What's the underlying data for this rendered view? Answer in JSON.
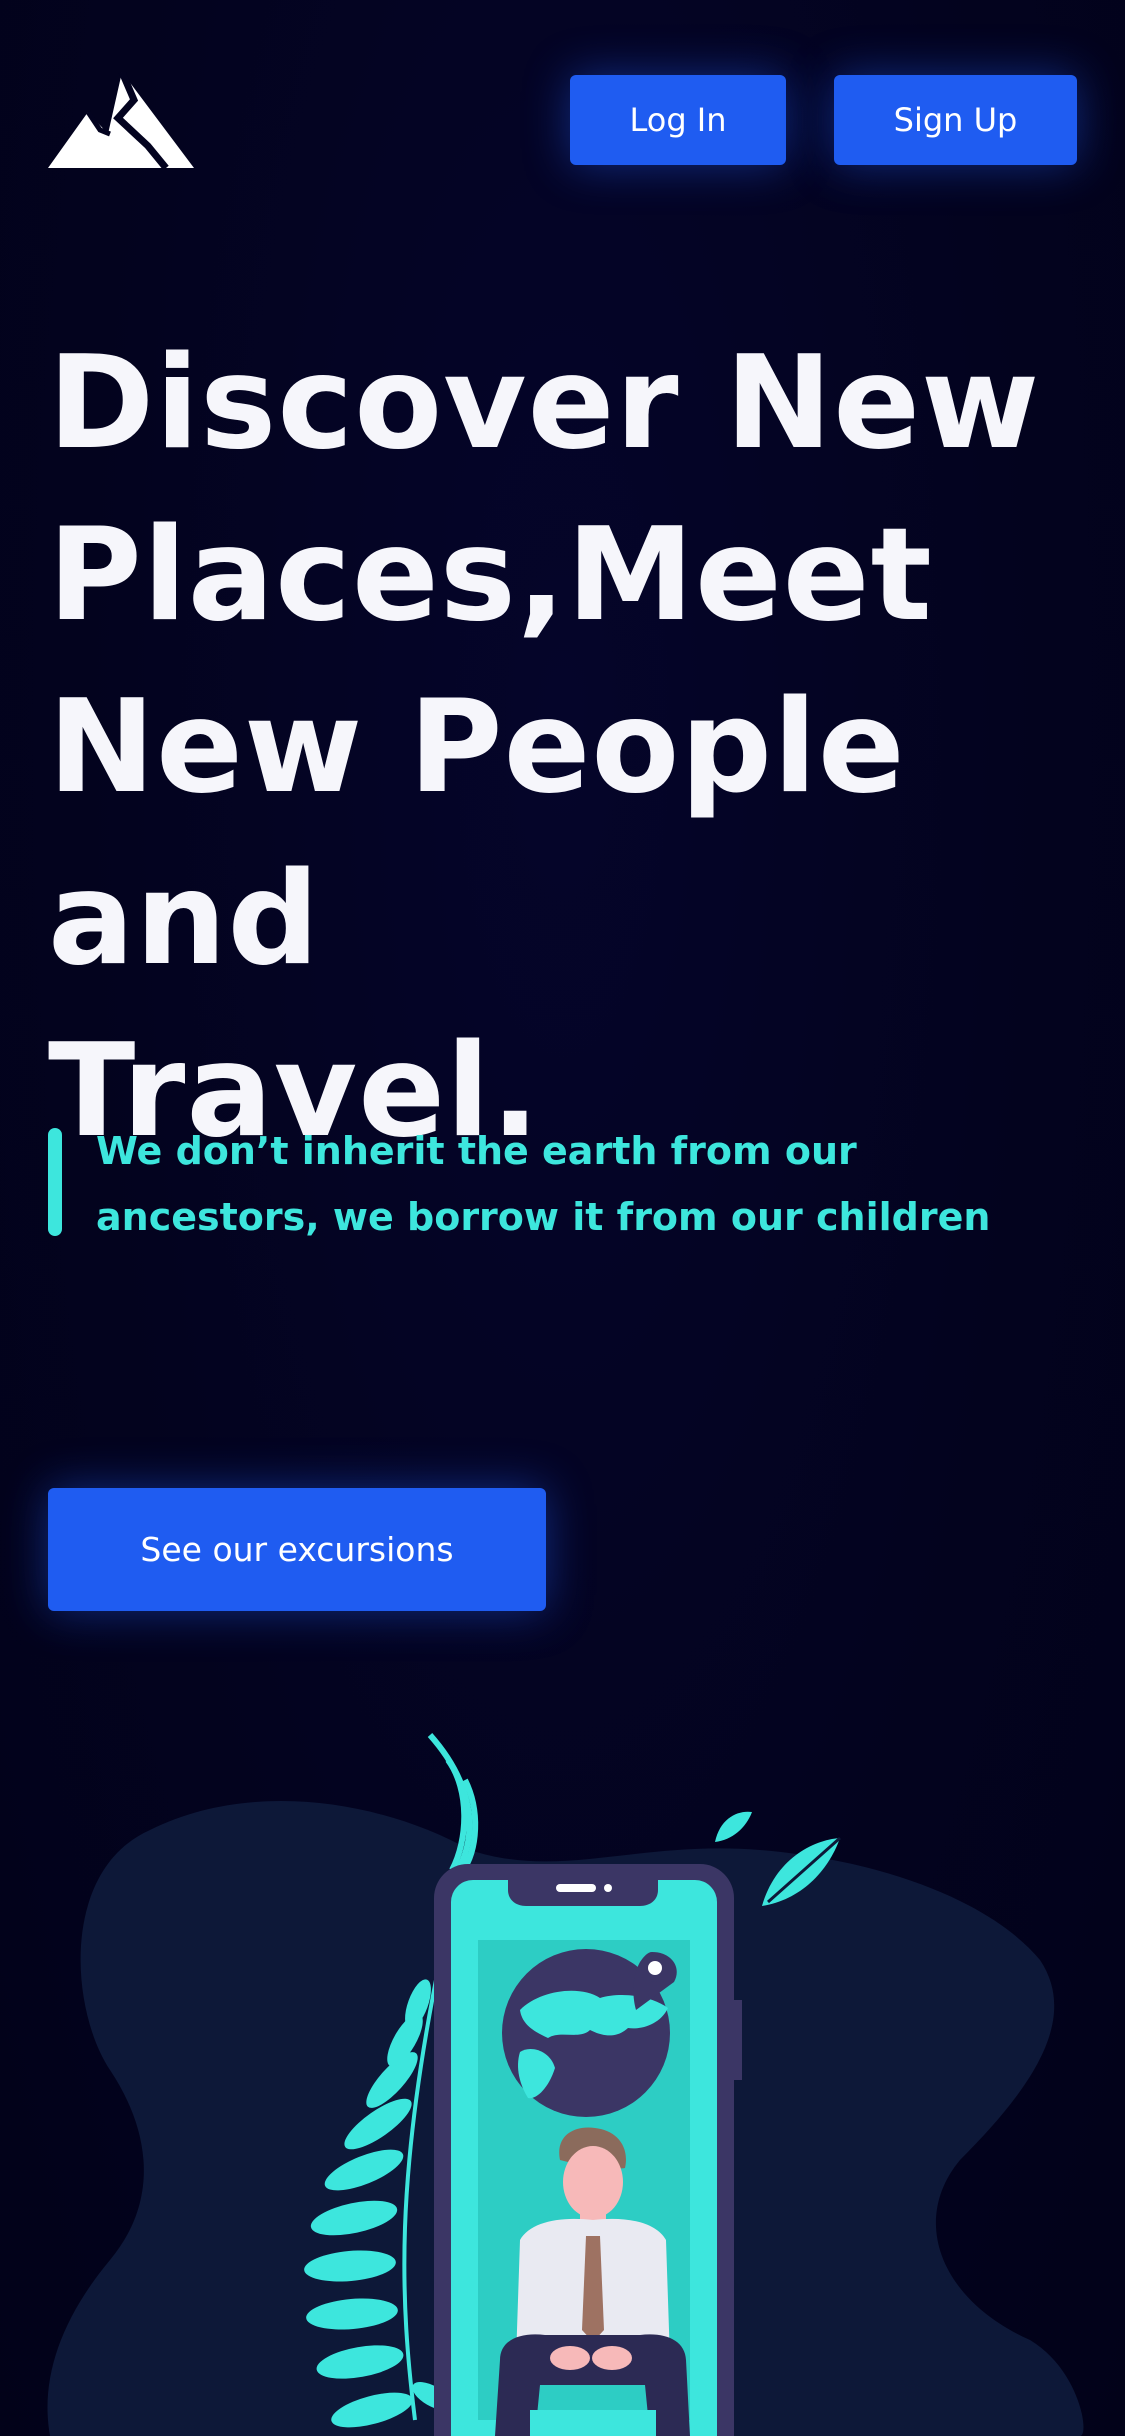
{
  "header": {
    "logo_icon": "mountain-logo-icon",
    "login_label": "Log In",
    "signup_label": "Sign Up"
  },
  "hero": {
    "title_lines": [
      "Discover New",
      "Places,Meet",
      "New People and",
      "Travel."
    ],
    "quote_lines": [
      "We don’t inherit the earth from our",
      "ancestors, we borrow it from our children"
    ],
    "cta_label": "See our excursions"
  },
  "illustration": {
    "icon": "phone-traveler-illustration",
    "elements": [
      "globe-icon",
      "location-pin-icon",
      "person-figure",
      "leaf-branch-icon",
      "leaf-icon"
    ]
  },
  "colors": {
    "background": "#03031f",
    "accent_blue": "#1f5cf1",
    "accent_teal": "#3de6dd",
    "blob": "#0d1838",
    "phone_frame": "#3b3665"
  }
}
